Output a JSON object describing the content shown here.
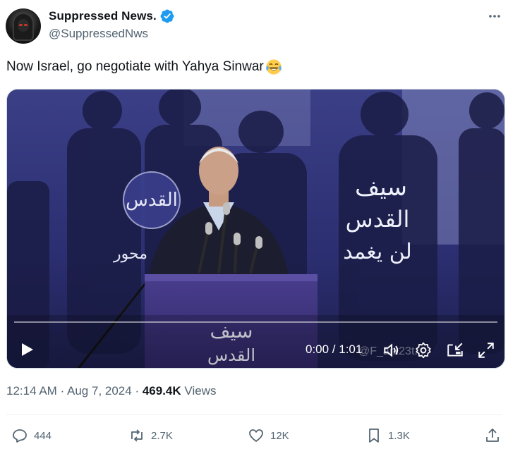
{
  "author": {
    "display_name": "Suppressed News.",
    "handle": "@SuppressedNws",
    "verified": true
  },
  "tweet": {
    "text": "Now Israel, go negotiate with Yahya Sinwar",
    "emoji": "face-with-tears-of-joy"
  },
  "video": {
    "time": "0:00 / 1:01",
    "watermark": "@F_arx23t..."
  },
  "meta": {
    "time": "12:14 AM",
    "date": "Aug 7, 2024",
    "views_count": "469.4K",
    "views_label": "Views"
  },
  "actions": {
    "replies": "444",
    "reposts": "2.7K",
    "likes": "12K",
    "bookmarks": "1.3K"
  },
  "colors": {
    "verified": "#1d9bf0",
    "text_primary": "#0f1419",
    "text_secondary": "#536471"
  }
}
